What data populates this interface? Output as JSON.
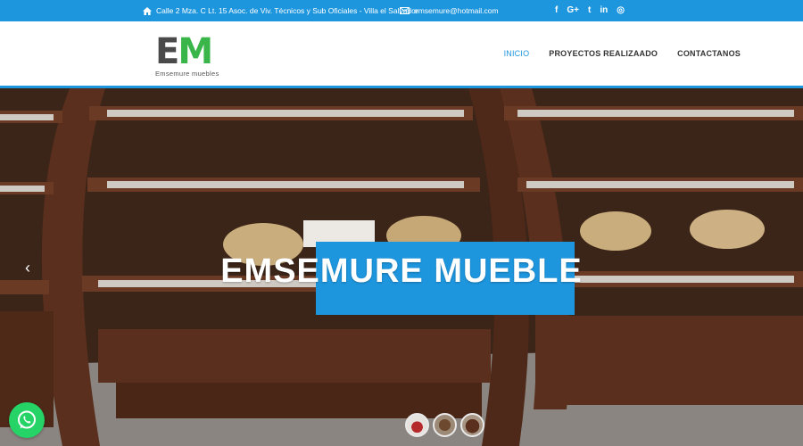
{
  "topbar": {
    "address": "Calle 2 Mza. C Lt. 15 Asoc. de Viv. Técnicos y Sub Oficiales - Villa el Salvador",
    "email": "emsemure@hotmail.com",
    "social": [
      {
        "name": "facebook",
        "glyph": "f"
      },
      {
        "name": "google-plus",
        "glyph": "G+"
      },
      {
        "name": "twitter",
        "glyph": "t"
      },
      {
        "name": "linkedin",
        "glyph": "in"
      },
      {
        "name": "instagram",
        "glyph": "◎"
      }
    ]
  },
  "logo": {
    "letter_e": "E",
    "letter_m": "M",
    "tagline": "Emsemure muebles"
  },
  "nav": {
    "items": [
      {
        "label": "INICIO",
        "active": true
      },
      {
        "label": "PROYECTOS REALIZAADO",
        "active": false
      },
      {
        "label": "CONTACTANOS",
        "active": false
      }
    ]
  },
  "hero": {
    "title": "EMSEMURE MUEBLE",
    "prev_arrow": "‹",
    "slides": 3
  },
  "colors": {
    "primary": "#1e96de",
    "logo_green": "#3ab549",
    "logo_gray": "#4a4a4a",
    "whatsapp": "#25d366"
  },
  "icons": [
    "home-icon",
    "envelope-icon",
    "whatsapp-icon",
    "chevron-left-icon"
  ]
}
